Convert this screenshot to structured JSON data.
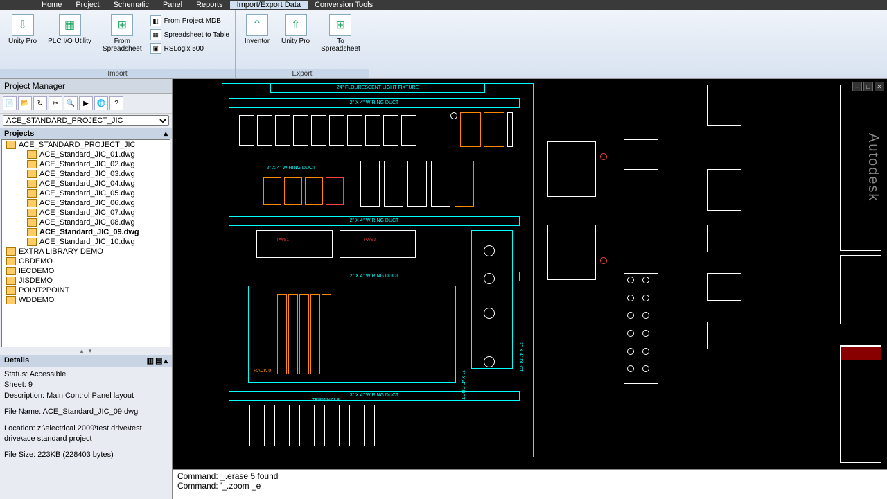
{
  "ribbonTabs": [
    "Home",
    "Project",
    "Schematic",
    "Panel",
    "Reports",
    "Import/Export Data",
    "Conversion Tools"
  ],
  "activeTab": "Import/Export Data",
  "ribbon": {
    "import": {
      "label": "Import",
      "unityPro": "Unity Pro",
      "plcIO": "PLC I/O Utility",
      "fromSpreadsheet": "From\nSpreadsheet",
      "fromMDB": "From Project MDB",
      "toTable": "Spreadsheet to Table",
      "rslogix": "RSLogix 500"
    },
    "export": {
      "label": "Export",
      "inventor": "Inventor",
      "unityPro": "Unity Pro",
      "toSpreadsheet": "To\nSpreadsheet"
    }
  },
  "pm": {
    "title": "Project Manager",
    "activeProject": "ACE_STANDARD_PROJECT_JIC",
    "projectsHdr": "Projects",
    "tree": {
      "root": "ACE_STANDARD_PROJECT_JIC",
      "files": [
        "ACE_Standard_JIC_01.dwg",
        "ACE_Standard_JIC_02.dwg",
        "ACE_Standard_JIC_03.dwg",
        "ACE_Standard_JIC_04.dwg",
        "ACE_Standard_JIC_05.dwg",
        "ACE_Standard_JIC_06.dwg",
        "ACE_Standard_JIC_07.dwg",
        "ACE_Standard_JIC_08.dwg",
        "ACE_Standard_JIC_09.dwg",
        "ACE_Standard_JIC_10.dwg"
      ],
      "selectedIndex": 8,
      "otherProjects": [
        "EXTRA LIBRARY DEMO",
        "GBDEMO",
        "IECDEMO",
        "JISDEMO",
        "POINT2POINT",
        "WDDEMO"
      ]
    },
    "detailsHdr": "Details",
    "details": {
      "status": "Status: Accessible",
      "sheet": "Sheet: 9",
      "desc": "Description: Main Control Panel layout",
      "fileName": "File Name: ACE_Standard_JIC_09.dwg",
      "location": "Location: z:\\electrical 2009\\test drive\\test drive\\ace standard project",
      "fileSize": "File Size: 223KB (228403 bytes)"
    }
  },
  "drawing": {
    "lightFixture": "24\" FLOURESCENT LIGHT FIXTURE",
    "duct2x4": "2\" X 4\" WIRING DUCT",
    "duct3x4": "3\" X 4\" WIRING DUCT",
    "terminals": "TERMINALS",
    "rack": "RACK 0",
    "vertDuct": "2\" X 4\" DUCT",
    "logo": "Autodesk"
  },
  "cmd": {
    "line1": "Command: _.erase 5 found",
    "line2": "Command: '_.zoom _e"
  }
}
